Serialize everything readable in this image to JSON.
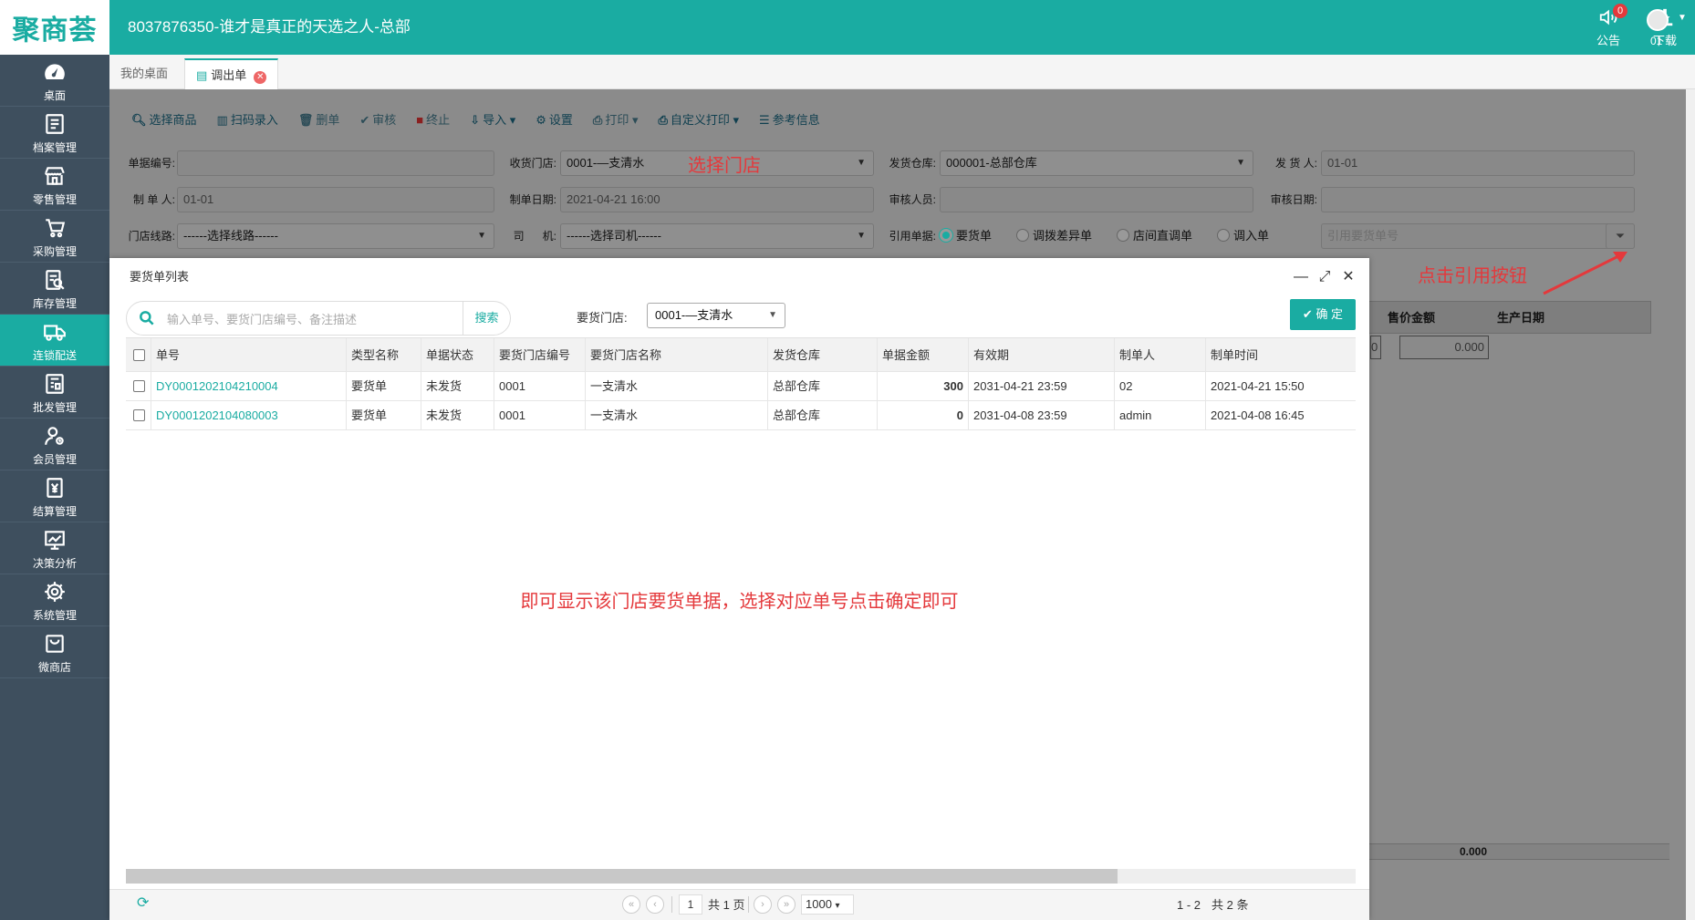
{
  "header": {
    "logo": "聚商荟",
    "title": "8037876350-谁才是真正的天选之人-总部",
    "notice_label": "公告",
    "notice_badge": "0",
    "download_label": "下载",
    "user_label": "01"
  },
  "sidebar": {
    "items": [
      {
        "label": "桌面",
        "icon": "dashboard-icon"
      },
      {
        "label": "档案管理",
        "icon": "archive-icon"
      },
      {
        "label": "零售管理",
        "icon": "store-icon"
      },
      {
        "label": "采购管理",
        "icon": "cart-icon"
      },
      {
        "label": "库存管理",
        "icon": "inventory-search-icon"
      },
      {
        "label": "连锁配送",
        "icon": "truck-icon",
        "active": true
      },
      {
        "label": "批发管理",
        "icon": "wholesale-icon"
      },
      {
        "label": "会员管理",
        "icon": "member-icon"
      },
      {
        "label": "结算管理",
        "icon": "settlement-icon"
      },
      {
        "label": "决策分析",
        "icon": "chart-icon"
      },
      {
        "label": "系统管理",
        "icon": "gear-icon"
      },
      {
        "label": "微商店",
        "icon": "shop-bag-icon"
      }
    ]
  },
  "tabs": {
    "desk": "我的桌面",
    "current": "调出单"
  },
  "toolbar": {
    "select_goods": "选择商品",
    "scan_entry": "扫码录入",
    "delete": "删单",
    "review": "审核",
    "terminate": "终止",
    "import": "导入",
    "settings": "设置",
    "print": "打印",
    "custom_print": "自定义打印",
    "ref_info": "参考信息"
  },
  "form": {
    "doc_no_label": "单据编号:",
    "doc_no_value": "",
    "recv_store_label": "收货门店:",
    "recv_store_value": "0001-—支清水",
    "ship_wh_label": "发货仓库:",
    "ship_wh_value": "000001-总部仓库",
    "shipper_label": "发 货 人:",
    "shipper_value": "01-01",
    "maker_label": "制 单 人:",
    "maker_value": "01-01",
    "make_date_label": "制单日期:",
    "make_date_value": "2021-04-21 16:00",
    "reviewer_label": "审核人员:",
    "reviewer_value": "",
    "review_date_label": "审核日期:",
    "review_date_value": "",
    "route_label": "门店线路:",
    "route_value": "------选择线路------",
    "driver_label": "司      机:",
    "driver_value": "------选择司机------",
    "ref_doc_label": "引用单据:",
    "ref_options": [
      "要货单",
      "调拨差异单",
      "店间直调单",
      "调入单"
    ],
    "ref_selected": "要货单",
    "ref_placeholder": "引用要货单号"
  },
  "annotations": {
    "select_store": "选择门店",
    "click_ref": "点击引用按钮",
    "result_note": "即可显示该门店要货单据，选择对应单号点击确定即可"
  },
  "bg_table": {
    "headers": [
      "售价金额",
      "生产日期"
    ],
    "cell_left": "0",
    "cell_value": "0.000",
    "footer_total": "0.000"
  },
  "modal": {
    "title": "要货单列表",
    "search_placeholder": "输入单号、要货门店编号、备注描述",
    "search_btn": "搜索",
    "store_label": "要货门店:",
    "store_value": "0001-—支清水",
    "ok_btn": "确 定",
    "columns": [
      "单号",
      "类型名称",
      "单据状态",
      "要货门店编号",
      "要货门店名称",
      "发货仓库",
      "单据金额",
      "有效期",
      "制单人",
      "制单时间"
    ],
    "rows": [
      {
        "no": "DY0001202104210004",
        "type": "要货单",
        "status": "未发货",
        "store_code": "0001",
        "store_name": "一支清水",
        "warehouse": "总部仓库",
        "amount": "300",
        "valid": "2031-04-21 23:59",
        "maker": "02",
        "time": "2021-04-21 15:50"
      },
      {
        "no": "DY0001202104080003",
        "type": "要货单",
        "status": "未发货",
        "store_code": "0001",
        "store_name": "一支清水",
        "warehouse": "总部仓库",
        "amount": "0",
        "valid": "2031-04-08 23:59",
        "maker": "admin",
        "time": "2021-04-08 16:45"
      }
    ],
    "pager": {
      "page": "1",
      "total_pages": "共 1 页",
      "page_size": "1000",
      "range": "1 - 2",
      "total": "共 2 条"
    }
  }
}
